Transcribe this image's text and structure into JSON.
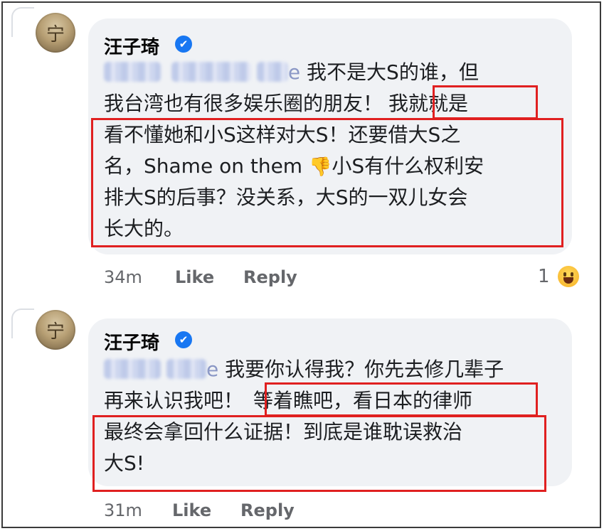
{
  "comments": [
    {
      "author": "汪子琦",
      "verified_badge": "✔",
      "mention_suffix": "e",
      "lines": [
        "我不是大S的谁，但",
        "我台湾也有很多娱乐圈的朋友！",
        "我就就是",
        "看不懂她和小S这样对大S！还要借大S之",
        "名，Shame on them",
        "小S有什么权利安",
        "排大S的后事？没关系，大S的一双儿女会",
        "长大的。"
      ],
      "thumb_icon": "thumbs-down-icon",
      "thumb_glyph": "👎",
      "time": "34m",
      "like_label": "Like",
      "reply_label": "Reply",
      "reaction_count": "1",
      "reaction_icon": "haha-emoji-icon"
    },
    {
      "author": "汪子琦",
      "verified_badge": "✔",
      "mention_suffix": "e",
      "lines": [
        "我要你认得我？你先去修几辈子",
        "再来认识我吧！",
        "等着瞧吧，看日本的律师",
        "最终会拿回什么证据！到底是谁耽误救治",
        "大S!"
      ],
      "time": "31m",
      "like_label": "Like",
      "reply_label": "Reply"
    }
  ],
  "colors": {
    "bubble": "#f0f2f5",
    "highlight_box": "#e02020",
    "verified": "#1877f2",
    "meta_text": "#65676b"
  }
}
